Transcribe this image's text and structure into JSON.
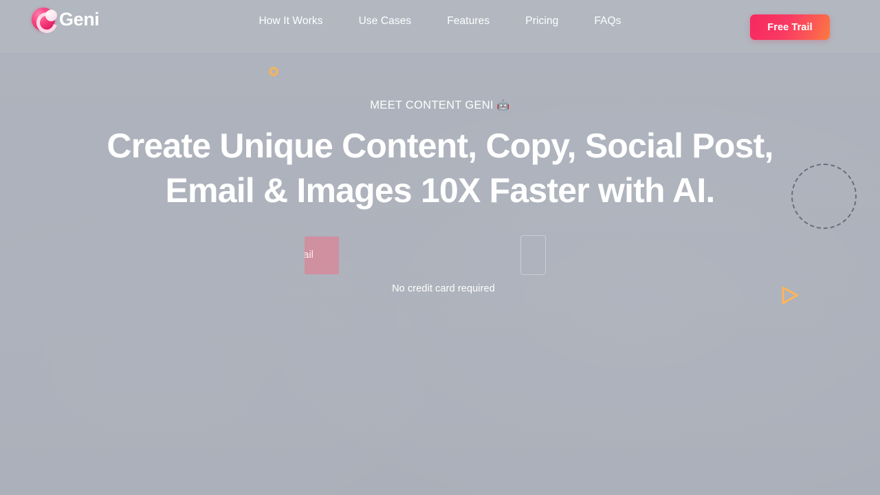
{
  "brand": {
    "name": "Geni",
    "logo_icon": "geni-circle-c-logo",
    "colors": {
      "pink": "#f6407e",
      "magenta": "#e01e63"
    }
  },
  "header": {
    "nav": [
      {
        "label": "How It Works"
      },
      {
        "label": "Use Cases"
      },
      {
        "label": "Features"
      },
      {
        "label": "Pricing"
      },
      {
        "label": "FAQs"
      }
    ],
    "cta": {
      "label": "Free Trail",
      "gradient_from": "#f6285f",
      "gradient_to": "#fb7b3f"
    }
  },
  "hero": {
    "eyebrow": "MEET CONTENT GENI",
    "eyebrow_emoji": "🤖",
    "title_line_1": "Create Unique Content, Copy, Social Post,",
    "title_line_2": "Email & Images 10X Faster with AI.",
    "signup": {
      "email_visible_text": "ail",
      "email_placeholder": "Enter your email",
      "submit_label": ""
    },
    "footnote": "No credit card required"
  },
  "decor": {
    "ring_color": "#f0b45f",
    "dashed_circle_color": "#5d626e",
    "play_color": "#fbb45c",
    "background_color": "#adb2bc"
  }
}
